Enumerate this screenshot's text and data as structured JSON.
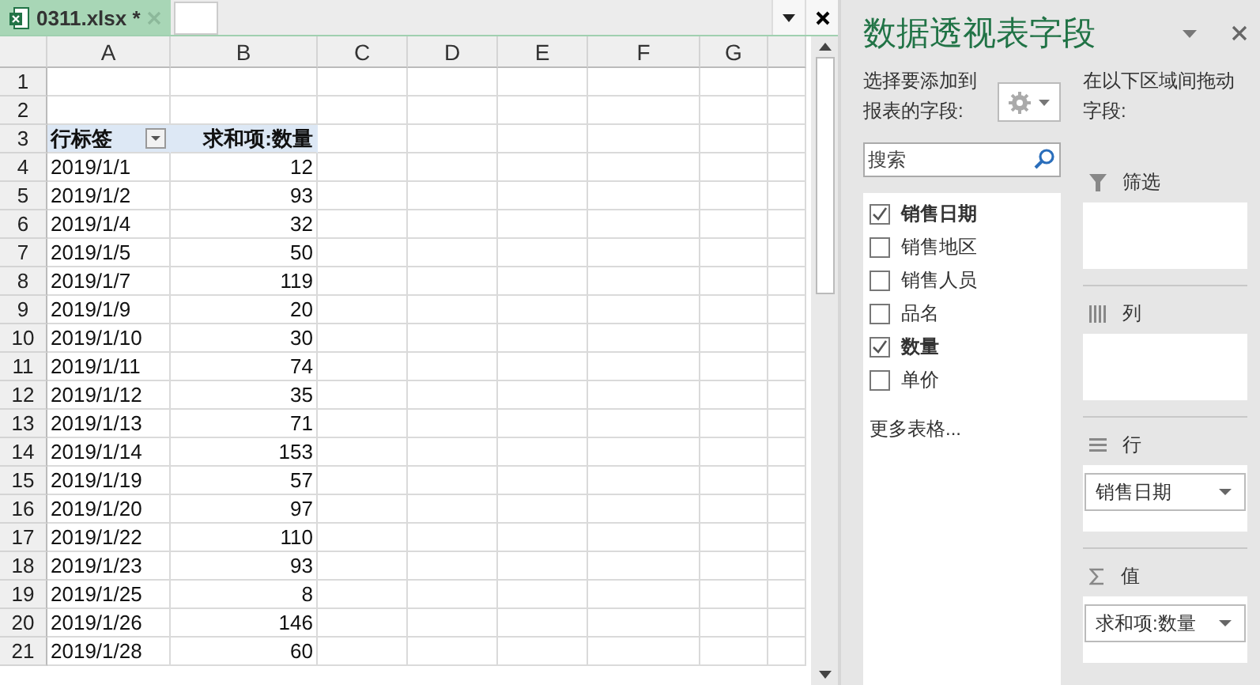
{
  "tabs": [
    {
      "label": "0311.xlsx *",
      "selected": true
    }
  ],
  "sheet": {
    "columns": [
      "A",
      "B",
      "C",
      "D",
      "E",
      "F",
      "G"
    ],
    "rows": [
      {
        "number": "1"
      },
      {
        "number": "2"
      },
      {
        "number": "3",
        "kind": "header",
        "label": "行标签",
        "value": "求和项:数量"
      },
      {
        "number": "4",
        "label": "2019/1/1",
        "value": "12"
      },
      {
        "number": "5",
        "label": "2019/1/2",
        "value": "93"
      },
      {
        "number": "6",
        "label": "2019/1/4",
        "value": "32"
      },
      {
        "number": "7",
        "label": "2019/1/5",
        "value": "50"
      },
      {
        "number": "8",
        "label": "2019/1/7",
        "value": "119"
      },
      {
        "number": "9",
        "label": "2019/1/9",
        "value": "20"
      },
      {
        "number": "10",
        "label": "2019/1/10",
        "value": "30"
      },
      {
        "number": "11",
        "label": "2019/1/11",
        "value": "74"
      },
      {
        "number": "12",
        "label": "2019/1/12",
        "value": "35"
      },
      {
        "number": "13",
        "label": "2019/1/13",
        "value": "71"
      },
      {
        "number": "14",
        "label": "2019/1/14",
        "value": "153"
      },
      {
        "number": "15",
        "label": "2019/1/19",
        "value": "57"
      },
      {
        "number": "16",
        "label": "2019/1/20",
        "value": "97"
      },
      {
        "number": "17",
        "label": "2019/1/22",
        "value": "110"
      },
      {
        "number": "18",
        "label": "2019/1/23",
        "value": "93"
      },
      {
        "number": "19",
        "label": "2019/1/25",
        "value": "8"
      },
      {
        "number": "20",
        "label": "2019/1/26",
        "value": "146"
      },
      {
        "number": "21",
        "label": "2019/1/28",
        "value": "60"
      }
    ]
  },
  "panel": {
    "title": "数据透视表字段",
    "choose_label": "选择要添加到报表的字段:",
    "search": {
      "placeholder": "搜索"
    },
    "fields": [
      {
        "label": "销售日期",
        "checked": true
      },
      {
        "label": "销售地区",
        "checked": false
      },
      {
        "label": "销售人员",
        "checked": false
      },
      {
        "label": "品名",
        "checked": false
      },
      {
        "label": "数量",
        "checked": true
      },
      {
        "label": "单价",
        "checked": false
      }
    ],
    "more_tables": "更多表格...",
    "drag_label": "在以下区域间拖动字段:",
    "areas": [
      {
        "kind": "filter",
        "label": "筛选"
      },
      {
        "kind": "columns",
        "label": "列"
      },
      {
        "kind": "rows",
        "label": "行",
        "items": [
          "销售日期"
        ]
      },
      {
        "kind": "values",
        "label": "值",
        "items": [
          "求和项:数量"
        ]
      }
    ]
  }
}
